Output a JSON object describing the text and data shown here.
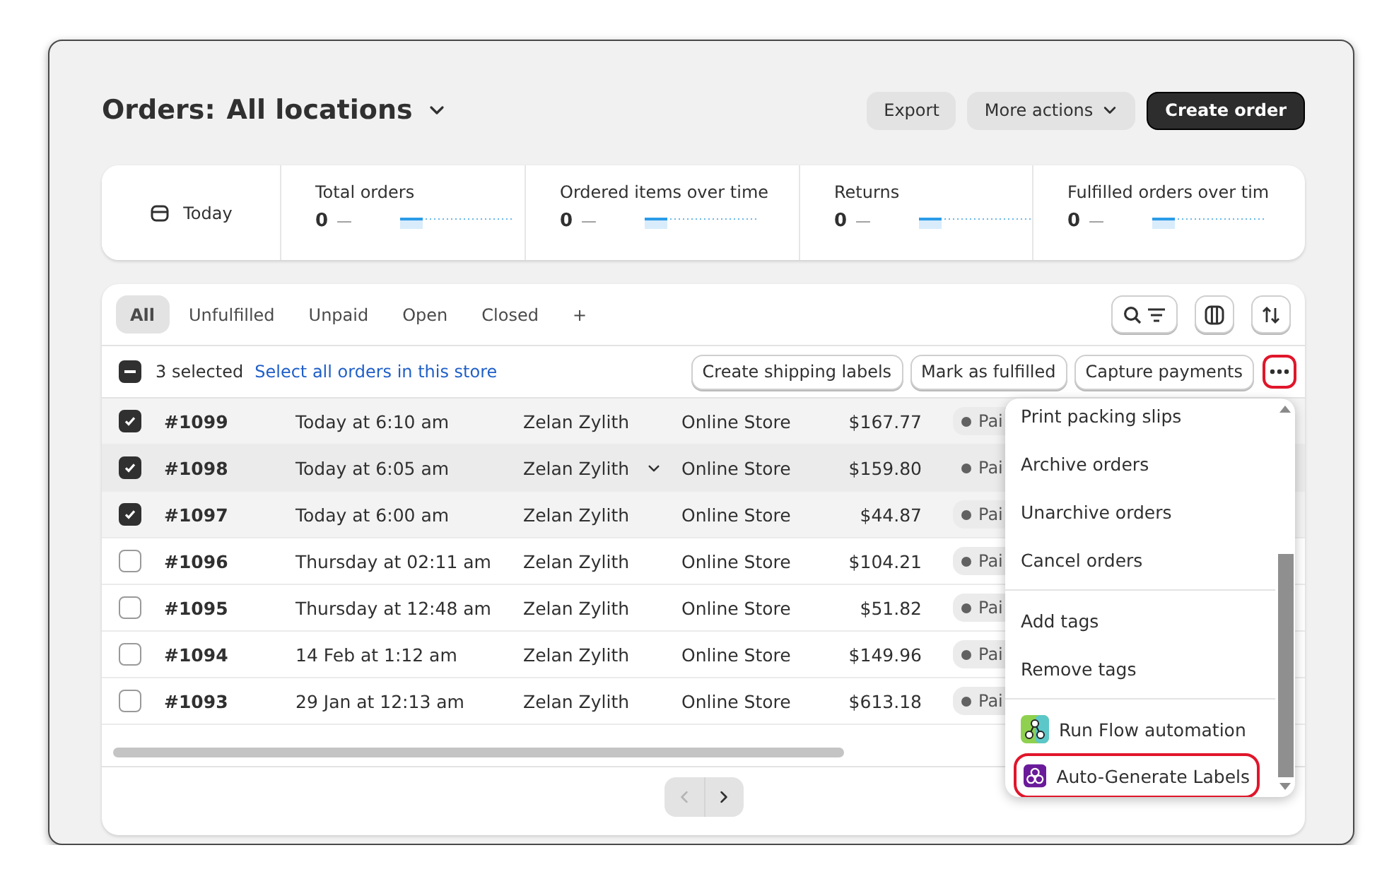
{
  "header": {
    "title": "Orders:",
    "location": "All locations",
    "buttons": [
      {
        "label": "Export",
        "kind": "secondary"
      },
      {
        "label": "More actions",
        "kind": "menu"
      },
      {
        "label": "Create order",
        "kind": "primary"
      }
    ]
  },
  "stats": {
    "period": "Today",
    "metrics": [
      {
        "label": "Total orders",
        "value": "0",
        "trend": "—"
      },
      {
        "label": "Ordered items over time",
        "value": "0",
        "trend": "—"
      },
      {
        "label": "Returns",
        "value": "0",
        "trend": "—"
      },
      {
        "label": "Fulfilled orders over tim",
        "value": "0",
        "trend": "—"
      }
    ]
  },
  "tabs": [
    {
      "label": "All",
      "selected": true
    },
    {
      "label": "Unfulfilled",
      "selected": false
    },
    {
      "label": "Unpaid",
      "selected": false
    },
    {
      "label": "Open",
      "selected": false
    },
    {
      "label": "Closed",
      "selected": false
    },
    {
      "label": "+",
      "selected": false
    }
  ],
  "bulk": {
    "indeterminate": true,
    "count": "3 selected",
    "select_all": "Select all orders in this store",
    "actions": [
      "Create shipping labels",
      "Mark as fulfilled",
      "Capture payments"
    ],
    "more_highlighted": true
  },
  "rows": [
    {
      "order": "#1099",
      "date": "Today at 6:10 am",
      "customer": "Zelan Zylith",
      "channel": "Online Store",
      "total": "$167.77",
      "payment": "Pai",
      "checked": true,
      "hovered": false
    },
    {
      "order": "#1098",
      "date": "Today at 6:05 am",
      "customer": "Zelan Zylith",
      "channel": "Online Store",
      "total": "$159.80",
      "payment": "Pai",
      "checked": true,
      "hovered": true
    },
    {
      "order": "#1097",
      "date": "Today at 6:00 am",
      "customer": "Zelan Zylith",
      "channel": "Online Store",
      "total": "$44.87",
      "payment": "Pai",
      "checked": true,
      "hovered": false
    },
    {
      "order": "#1096",
      "date": "Thursday at 02:11 am",
      "customer": "Zelan Zylith",
      "channel": "Online Store",
      "total": "$104.21",
      "payment": "Pai",
      "checked": false,
      "hovered": false
    },
    {
      "order": "#1095",
      "date": "Thursday at 12:48 am",
      "customer": "Zelan Zylith",
      "channel": "Online Store",
      "total": "$51.82",
      "payment": "Pai",
      "checked": false,
      "hovered": false
    },
    {
      "order": "#1094",
      "date": "14 Feb at 1:12 am",
      "customer": "Zelan Zylith",
      "channel": "Online Store",
      "total": "$149.96",
      "payment": "Pai",
      "checked": false,
      "hovered": false
    },
    {
      "order": "#1093",
      "date": "29 Jan at 12:13 am",
      "customer": "Zelan Zylith",
      "channel": "Online Store",
      "total": "$613.18",
      "payment": "Pai",
      "checked": false,
      "hovered": false
    }
  ],
  "menu": {
    "groups": [
      [
        {
          "label": "Print packing slips",
          "kind": "text",
          "highlighted": false
        },
        {
          "label": "Archive orders",
          "kind": "text",
          "highlighted": false
        },
        {
          "label": "Unarchive orders",
          "kind": "text",
          "highlighted": false
        },
        {
          "label": "Cancel orders",
          "kind": "text",
          "highlighted": false
        }
      ],
      [
        {
          "label": "Add tags",
          "kind": "text",
          "highlighted": false
        },
        {
          "label": "Remove tags",
          "kind": "text",
          "highlighted": false
        }
      ],
      [
        {
          "label": "Run Flow automation",
          "kind": "flow",
          "highlighted": false
        },
        {
          "label": "Auto-Generate Labels",
          "kind": "app",
          "highlighted": true
        }
      ]
    ]
  }
}
